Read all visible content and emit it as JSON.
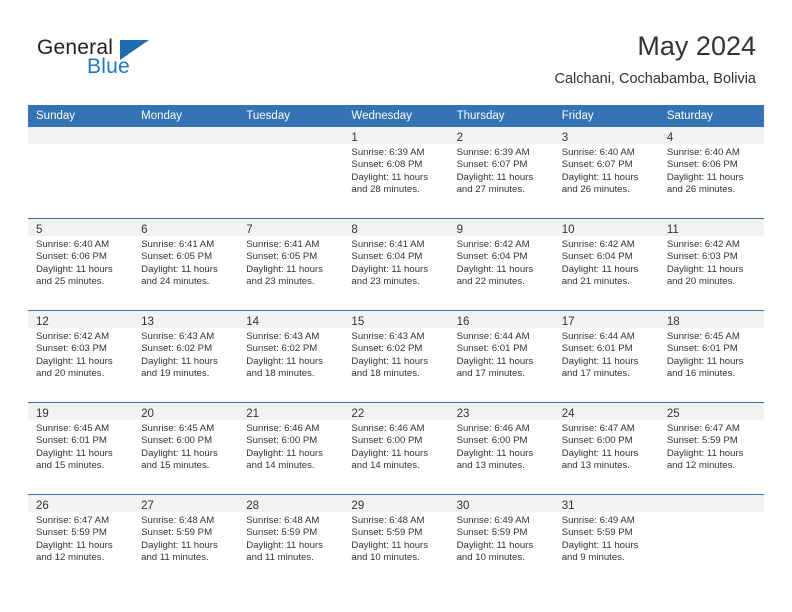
{
  "brand": {
    "name_part1": "General",
    "name_part2": "Blue",
    "accent_color": "#1f78c1",
    "triangle_color": "#1f6cb0"
  },
  "header": {
    "title": "May 2024",
    "subtitle": "Calchani, Cochabamba, Bolivia",
    "header_bar_color": "#3272b5",
    "date_band_color": "#f2f2f2"
  },
  "weekdays": [
    "Sunday",
    "Monday",
    "Tuesday",
    "Wednesday",
    "Thursday",
    "Friday",
    "Saturday"
  ],
  "labels": {
    "sunrise_prefix": "Sunrise:",
    "sunset_prefix": "Sunset:",
    "daylight_prefix": "Daylight:"
  },
  "weeks": [
    [
      {
        "empty": true
      },
      {
        "empty": true
      },
      {
        "empty": true
      },
      {
        "day": "1",
        "sunrise": "Sunrise: 6:39 AM",
        "sunset": "Sunset: 6:08 PM",
        "daylight1": "Daylight: 11 hours",
        "daylight2": "and 28 minutes."
      },
      {
        "day": "2",
        "sunrise": "Sunrise: 6:39 AM",
        "sunset": "Sunset: 6:07 PM",
        "daylight1": "Daylight: 11 hours",
        "daylight2": "and 27 minutes."
      },
      {
        "day": "3",
        "sunrise": "Sunrise: 6:40 AM",
        "sunset": "Sunset: 6:07 PM",
        "daylight1": "Daylight: 11 hours",
        "daylight2": "and 26 minutes."
      },
      {
        "day": "4",
        "sunrise": "Sunrise: 6:40 AM",
        "sunset": "Sunset: 6:06 PM",
        "daylight1": "Daylight: 11 hours",
        "daylight2": "and 26 minutes."
      }
    ],
    [
      {
        "day": "5",
        "sunrise": "Sunrise: 6:40 AM",
        "sunset": "Sunset: 6:06 PM",
        "daylight1": "Daylight: 11 hours",
        "daylight2": "and 25 minutes."
      },
      {
        "day": "6",
        "sunrise": "Sunrise: 6:41 AM",
        "sunset": "Sunset: 6:05 PM",
        "daylight1": "Daylight: 11 hours",
        "daylight2": "and 24 minutes."
      },
      {
        "day": "7",
        "sunrise": "Sunrise: 6:41 AM",
        "sunset": "Sunset: 6:05 PM",
        "daylight1": "Daylight: 11 hours",
        "daylight2": "and 23 minutes."
      },
      {
        "day": "8",
        "sunrise": "Sunrise: 6:41 AM",
        "sunset": "Sunset: 6:04 PM",
        "daylight1": "Daylight: 11 hours",
        "daylight2": "and 23 minutes."
      },
      {
        "day": "9",
        "sunrise": "Sunrise: 6:42 AM",
        "sunset": "Sunset: 6:04 PM",
        "daylight1": "Daylight: 11 hours",
        "daylight2": "and 22 minutes."
      },
      {
        "day": "10",
        "sunrise": "Sunrise: 6:42 AM",
        "sunset": "Sunset: 6:04 PM",
        "daylight1": "Daylight: 11 hours",
        "daylight2": "and 21 minutes."
      },
      {
        "day": "11",
        "sunrise": "Sunrise: 6:42 AM",
        "sunset": "Sunset: 6:03 PM",
        "daylight1": "Daylight: 11 hours",
        "daylight2": "and 20 minutes."
      }
    ],
    [
      {
        "day": "12",
        "sunrise": "Sunrise: 6:42 AM",
        "sunset": "Sunset: 6:03 PM",
        "daylight1": "Daylight: 11 hours",
        "daylight2": "and 20 minutes."
      },
      {
        "day": "13",
        "sunrise": "Sunrise: 6:43 AM",
        "sunset": "Sunset: 6:02 PM",
        "daylight1": "Daylight: 11 hours",
        "daylight2": "and 19 minutes."
      },
      {
        "day": "14",
        "sunrise": "Sunrise: 6:43 AM",
        "sunset": "Sunset: 6:02 PM",
        "daylight1": "Daylight: 11 hours",
        "daylight2": "and 18 minutes."
      },
      {
        "day": "15",
        "sunrise": "Sunrise: 6:43 AM",
        "sunset": "Sunset: 6:02 PM",
        "daylight1": "Daylight: 11 hours",
        "daylight2": "and 18 minutes."
      },
      {
        "day": "16",
        "sunrise": "Sunrise: 6:44 AM",
        "sunset": "Sunset: 6:01 PM",
        "daylight1": "Daylight: 11 hours",
        "daylight2": "and 17 minutes."
      },
      {
        "day": "17",
        "sunrise": "Sunrise: 6:44 AM",
        "sunset": "Sunset: 6:01 PM",
        "daylight1": "Daylight: 11 hours",
        "daylight2": "and 17 minutes."
      },
      {
        "day": "18",
        "sunrise": "Sunrise: 6:45 AM",
        "sunset": "Sunset: 6:01 PM",
        "daylight1": "Daylight: 11 hours",
        "daylight2": "and 16 minutes."
      }
    ],
    [
      {
        "day": "19",
        "sunrise": "Sunrise: 6:45 AM",
        "sunset": "Sunset: 6:01 PM",
        "daylight1": "Daylight: 11 hours",
        "daylight2": "and 15 minutes."
      },
      {
        "day": "20",
        "sunrise": "Sunrise: 6:45 AM",
        "sunset": "Sunset: 6:00 PM",
        "daylight1": "Daylight: 11 hours",
        "daylight2": "and 15 minutes."
      },
      {
        "day": "21",
        "sunrise": "Sunrise: 6:46 AM",
        "sunset": "Sunset: 6:00 PM",
        "daylight1": "Daylight: 11 hours",
        "daylight2": "and 14 minutes."
      },
      {
        "day": "22",
        "sunrise": "Sunrise: 6:46 AM",
        "sunset": "Sunset: 6:00 PM",
        "daylight1": "Daylight: 11 hours",
        "daylight2": "and 14 minutes."
      },
      {
        "day": "23",
        "sunrise": "Sunrise: 6:46 AM",
        "sunset": "Sunset: 6:00 PM",
        "daylight1": "Daylight: 11 hours",
        "daylight2": "and 13 minutes."
      },
      {
        "day": "24",
        "sunrise": "Sunrise: 6:47 AM",
        "sunset": "Sunset: 6:00 PM",
        "daylight1": "Daylight: 11 hours",
        "daylight2": "and 13 minutes."
      },
      {
        "day": "25",
        "sunrise": "Sunrise: 6:47 AM",
        "sunset": "Sunset: 5:59 PM",
        "daylight1": "Daylight: 11 hours",
        "daylight2": "and 12 minutes."
      }
    ],
    [
      {
        "day": "26",
        "sunrise": "Sunrise: 6:47 AM",
        "sunset": "Sunset: 5:59 PM",
        "daylight1": "Daylight: 11 hours",
        "daylight2": "and 12 minutes."
      },
      {
        "day": "27",
        "sunrise": "Sunrise: 6:48 AM",
        "sunset": "Sunset: 5:59 PM",
        "daylight1": "Daylight: 11 hours",
        "daylight2": "and 11 minutes."
      },
      {
        "day": "28",
        "sunrise": "Sunrise: 6:48 AM",
        "sunset": "Sunset: 5:59 PM",
        "daylight1": "Daylight: 11 hours",
        "daylight2": "and 11 minutes."
      },
      {
        "day": "29",
        "sunrise": "Sunrise: 6:48 AM",
        "sunset": "Sunset: 5:59 PM",
        "daylight1": "Daylight: 11 hours",
        "daylight2": "and 10 minutes."
      },
      {
        "day": "30",
        "sunrise": "Sunrise: 6:49 AM",
        "sunset": "Sunset: 5:59 PM",
        "daylight1": "Daylight: 11 hours",
        "daylight2": "and 10 minutes."
      },
      {
        "day": "31",
        "sunrise": "Sunrise: 6:49 AM",
        "sunset": "Sunset: 5:59 PM",
        "daylight1": "Daylight: 11 hours",
        "daylight2": "and 9 minutes."
      },
      {
        "empty": true
      }
    ]
  ]
}
